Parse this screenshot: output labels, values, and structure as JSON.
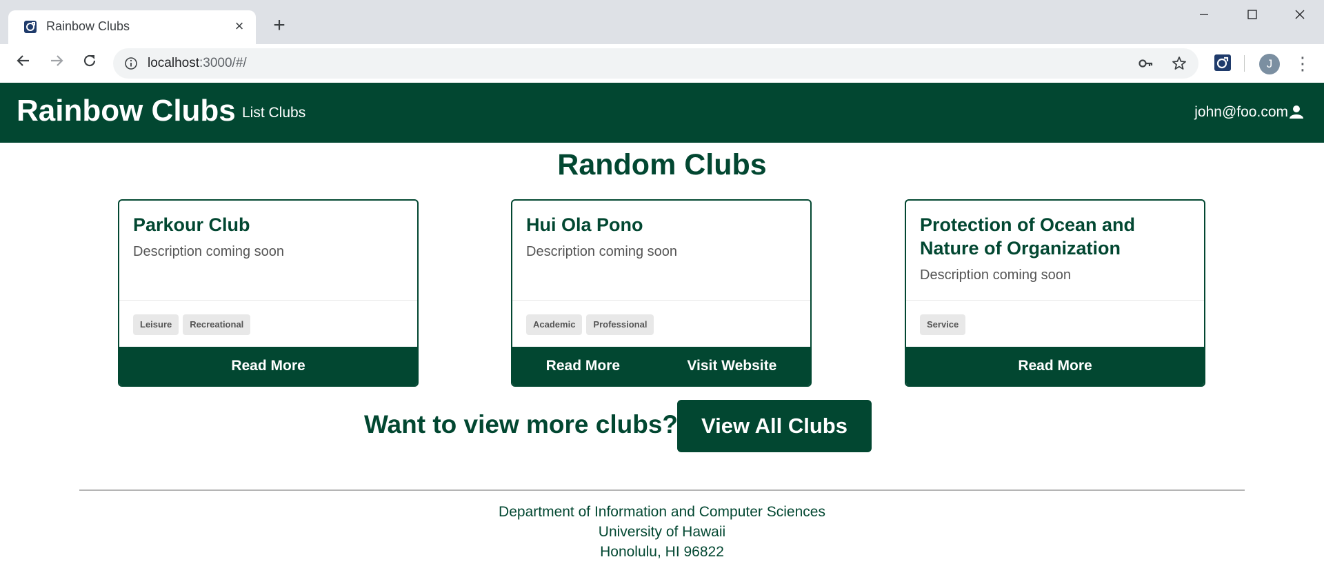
{
  "browser": {
    "tab_title": "Rainbow Clubs",
    "url_host": "localhost",
    "url_rest": ":3000/#/",
    "profile_initial": "J",
    "window_controls": [
      "minimize-icon",
      "maximize-icon",
      "close-icon"
    ]
  },
  "navbar": {
    "brand": "Rainbow Clubs",
    "link": "List Clubs",
    "user": "john@foo.com",
    "bg_color": "#024731"
  },
  "main": {
    "title": "Random Clubs",
    "clubs": [
      {
        "name": "Parkour Club",
        "description": "Description coming soon",
        "tags": [
          "Leisure",
          "Recreational"
        ],
        "actions": [
          "Read More"
        ]
      },
      {
        "name": "Hui Ola Pono",
        "description": "Description coming soon",
        "tags": [
          "Academic",
          "Professional"
        ],
        "actions": [
          "Read More",
          "Visit Website"
        ]
      },
      {
        "name": "Protection of Ocean and Nature of Organization",
        "description": "Description coming soon",
        "tags": [
          "Service"
        ],
        "actions": [
          "Read More"
        ]
      }
    ],
    "more_prompt": "Want to view more clubs?",
    "view_all_label": "View All Clubs"
  },
  "footer": {
    "line1": "Department of Information and Computer Sciences",
    "line2": "University of Hawaii",
    "line3": "Honolulu, HI 96822"
  }
}
